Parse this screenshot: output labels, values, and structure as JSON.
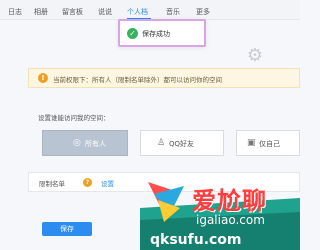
{
  "nav": {
    "items": [
      "日志",
      "相册",
      "留言板",
      "说说",
      "个人档",
      "音乐",
      "更多"
    ],
    "active_index": 4
  },
  "toast": {
    "text": "保存成功",
    "icon": "check-circle-icon"
  },
  "notice": {
    "text": "当前权限下：所有人（限制名单除外）都可以访问你的空间",
    "icon": "warning-icon"
  },
  "access": {
    "label": "设置谁能访问我的空间：",
    "options": [
      {
        "label": "所有人",
        "icon": "globe-icon",
        "selected": true
      },
      {
        "label": "QQ好友",
        "icon": "friends-icon",
        "selected": false
      },
      {
        "label": "仅自己",
        "icon": "lock-icon",
        "selected": false
      }
    ]
  },
  "whitelist": {
    "label": "限制名单",
    "link": "设置",
    "icon": "help-icon"
  },
  "actions": {
    "save": "保存"
  },
  "watermark": {
    "title": "爱尬聊",
    "line1": "igaliao.com",
    "line2": "qksufu.com"
  },
  "colors": {
    "accent": "#2d8cf0",
    "success": "#36b35c",
    "warning": "#f0a020",
    "selected_option": "#b9c4d2",
    "watermark_red": "#ff3d3d"
  }
}
